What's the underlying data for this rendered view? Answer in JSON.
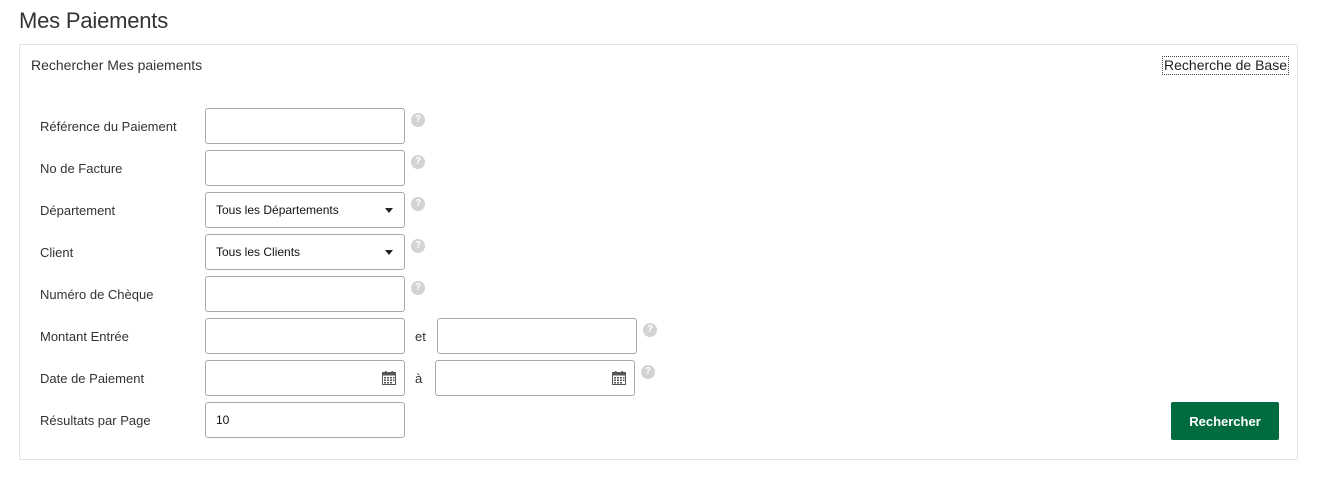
{
  "page_title": "Mes Paiements",
  "panel": {
    "heading": "Rechercher Mes paiements",
    "basic_search_link": "Recherche de Base"
  },
  "form": {
    "payment_reference": {
      "label": "Référence du Paiement",
      "value": ""
    },
    "invoice_number": {
      "label": "No de Facture",
      "value": ""
    },
    "department": {
      "label": "Département",
      "selected": "Tous les Départements"
    },
    "client": {
      "label": "Client",
      "selected": "Tous les Clients"
    },
    "cheque_number": {
      "label": "Numéro de Chèque",
      "value": ""
    },
    "amount": {
      "label": "Montant Entrée",
      "separator": "et",
      "from": "",
      "to": ""
    },
    "payment_date": {
      "label": "Date de Paiement",
      "separator": "à",
      "from": "",
      "to": ""
    },
    "results_per_page": {
      "label": "Résultats par Page",
      "value": "10"
    },
    "help_glyph": "?"
  },
  "search_button": "Rechercher",
  "colors": {
    "accent": "#006b3f",
    "help_icon": "#d3d3d3",
    "border": "#a9a9a9"
  },
  "icons": [
    "help-icon",
    "calendar-icon",
    "chevron-down-icon"
  ]
}
